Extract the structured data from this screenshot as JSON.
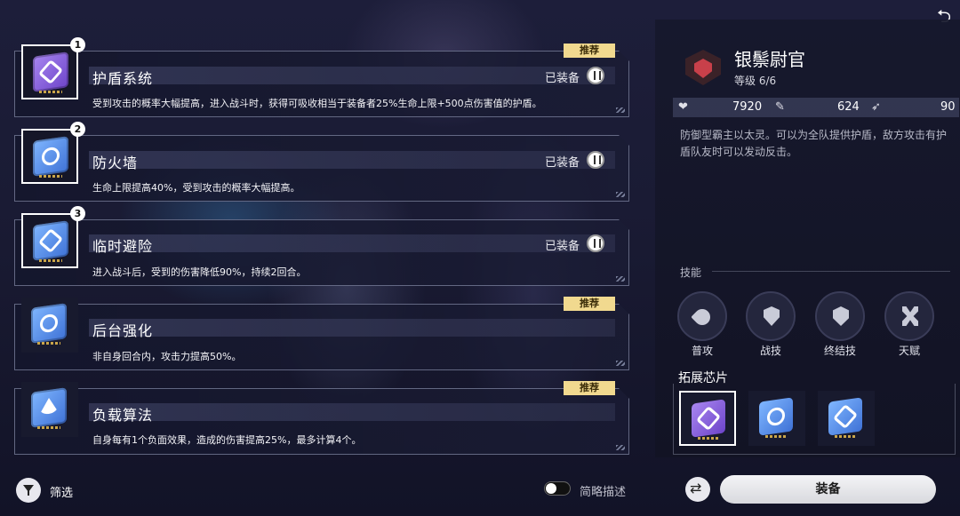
{
  "chips": [
    {
      "number": "1",
      "title": "护盾系统",
      "status": "已装备",
      "recommended": "推荐",
      "desc": "受到攻击的概率大幅提高，进入战斗时，获得可吸收相当于装备者25%生命上限+500点伤害值的护盾。",
      "icon": "shield-chip-icon",
      "color": "#7b55d8"
    },
    {
      "number": "2",
      "title": "防火墙",
      "status": "已装备",
      "recommended": "",
      "desc": "生命上限提高40%，受到攻击的概率大幅提高。",
      "icon": "firewall-chip-icon",
      "color": "#4f83e0"
    },
    {
      "number": "3",
      "title": "临时避险",
      "status": "已装备",
      "recommended": "",
      "desc": "进入战斗后，受到的伤害降低90%，持续2回合。",
      "icon": "refuge-chip-icon",
      "color": "#4f83e0"
    },
    {
      "number": "",
      "title": "后台强化",
      "status": "",
      "recommended": "推荐",
      "desc": "非自身回合内，攻击力提高50%。",
      "icon": "backstage-chip-icon",
      "color": "#4f83e0"
    },
    {
      "number": "",
      "title": "负载算法",
      "status": "",
      "recommended": "推荐",
      "desc": "自身每有1个负面效果，造成的伤害提高25%，最多计算4个。",
      "icon": "load-chip-icon",
      "color": "#4f83e0"
    }
  ],
  "bottom_left": {
    "filter_label": "筛选",
    "brief_label": "简略描述",
    "brief_on": false
  },
  "character": {
    "name": "银鬃尉官",
    "level": "等级 6/6",
    "hp": "7920",
    "attack": "624",
    "speed": "90",
    "description": "防御型霸主以太灵。可以为全队提供护盾，敌方攻击有护盾队友时可以发动反击。"
  },
  "skills": {
    "header": "技能",
    "items": [
      {
        "label": "普攻",
        "icon": "basic-attack-icon"
      },
      {
        "label": "战技",
        "icon": "skill-shield-icon"
      },
      {
        "label": "终结技",
        "icon": "ultimate-icon"
      },
      {
        "label": "天赋",
        "icon": "talent-icon"
      }
    ]
  },
  "expansion": {
    "header": "拓展芯片"
  },
  "actions": {
    "equip_label": "装备",
    "back_glyph": "⮌"
  }
}
